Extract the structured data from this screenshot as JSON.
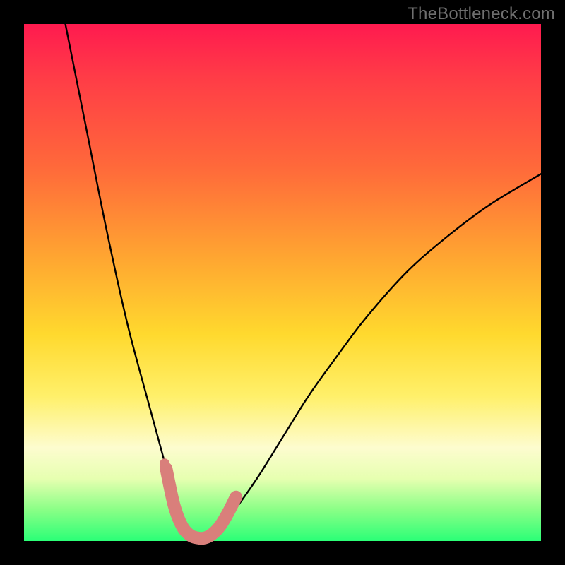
{
  "watermark": "TheBottleneck.com",
  "chart_data": {
    "type": "line",
    "title": "",
    "xlabel": "",
    "ylabel": "",
    "xlim": [
      0,
      100
    ],
    "ylim": [
      0,
      100
    ],
    "grid": false,
    "series": [
      {
        "name": "bottleneck-curve",
        "color": "#000000",
        "x": [
          8,
          12,
          16,
          20,
          24,
          27,
          29,
          31,
          33,
          35,
          37,
          40,
          45,
          50,
          55,
          60,
          66,
          74,
          82,
          90,
          100
        ],
        "y": [
          100,
          80,
          60,
          42,
          27,
          16,
          9,
          4,
          1.5,
          0.5,
          1.5,
          5,
          12,
          20,
          28,
          35,
          43,
          52,
          59,
          65,
          71
        ]
      },
      {
        "name": "valley-highlight",
        "color": "#d97f7b",
        "x": [
          27.5,
          29,
          30.5,
          32,
          33.5,
          35,
          36.5,
          38,
          39.5,
          41
        ],
        "y": [
          14,
          7,
          3,
          1.2,
          0.6,
          0.6,
          1.4,
          3,
          5.5,
          8.5
        ]
      }
    ],
    "markers": [
      {
        "name": "valley-dot",
        "x": 27.2,
        "y": 15,
        "color": "#d97f7b",
        "r": 7
      }
    ]
  }
}
